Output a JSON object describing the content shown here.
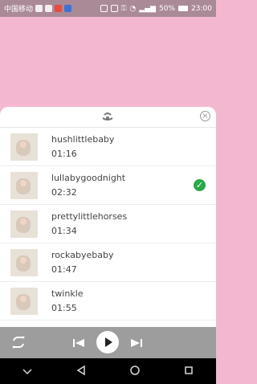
{
  "status": {
    "carrier": "中国移动",
    "battery": "50%",
    "time": "23:00"
  },
  "player_sheet": {
    "items": [
      {
        "title": "hushlittlebaby",
        "duration": "01:16",
        "selected": false
      },
      {
        "title": "lullabygoodnight",
        "duration": "02:32",
        "selected": true
      },
      {
        "title": "prettylittlehorses",
        "duration": "01:34",
        "selected": false
      },
      {
        "title": "rockabyebaby",
        "duration": "01:47",
        "selected": false
      },
      {
        "title": "twinkle",
        "duration": "01:55",
        "selected": false
      }
    ]
  },
  "colors": {
    "pink": "#f3b8cf",
    "player_bar": "#9d9d9d",
    "check": "#2aa84a"
  },
  "icons": {
    "sheet_handle": "cradle-icon",
    "close": "close-circle-icon",
    "repeat": "repeat-icon",
    "prev": "skip-previous-icon",
    "play": "play-icon",
    "next": "skip-next-icon",
    "nav_back": "back-triangle-icon",
    "nav_home": "home-circle-icon",
    "nav_recent": "recent-square-icon",
    "nav_down": "chevron-down-icon"
  }
}
